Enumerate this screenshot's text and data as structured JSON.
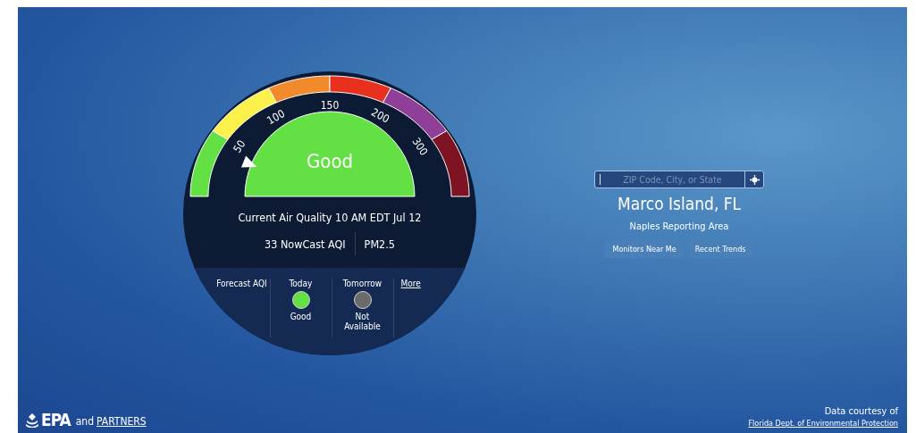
{
  "gauge": {
    "scale_labels": [
      "50",
      "100",
      "150",
      "200",
      "300"
    ],
    "category": "Good",
    "reading": "Current Air Quality 10 AM EDT Jul 12",
    "nowcast": "33 NowCast AQI",
    "pollutant": "PM2.5"
  },
  "forecast": {
    "label": "Forecast AQI",
    "days": [
      {
        "day": "Today",
        "status": "Good",
        "color": "#63e043"
      },
      {
        "day": "Tomorrow",
        "status": "Not Available",
        "color": "#6b6b6b"
      }
    ],
    "more_link": "More"
  },
  "search": {
    "placeholder": "ZIP Code, City, or State"
  },
  "location": {
    "name": "Marco Island, FL",
    "area": "Naples Reporting Area",
    "buttons": [
      "Monitors Near Me",
      "Recent Trends"
    ]
  },
  "footer": {
    "logo": "EPA",
    "joiner": "and",
    "partners_link": "PARTNERS",
    "credit": "Data courtesy of",
    "source_link": "Florida Dept. of Environmental Protection"
  }
}
